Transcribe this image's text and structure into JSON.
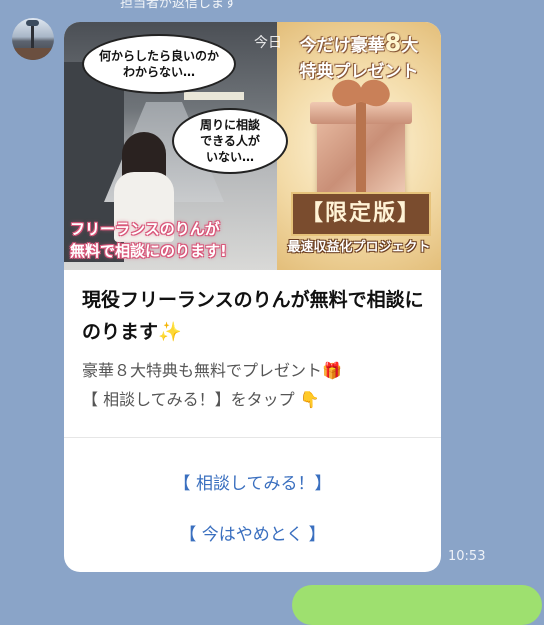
{
  "top_note": "担当者が返信します",
  "card": {
    "banner": {
      "time_label": "今日",
      "bubble1": "何からしたら良いのか\nわからない…",
      "bubble2": "周りに相談\nできる人が\nいない…",
      "banner_text_1": "フリーランスのりんが",
      "banner_text_2": "無料で相談にのります!",
      "promo_line1": "今だけ豪華",
      "promo_number": "8",
      "promo_line1_end": "大",
      "promo_line2": "特典プレゼント",
      "stamp": "【限定版】",
      "stamp_sub": "最速収益化プロジェクト"
    },
    "title": "現役フリーランスのりんが無料で相談にのります✨",
    "desc_line1": "豪華８大特典も無料でプレゼント🎁",
    "desc_line2": "【 相談してみる！】をタップ 👇",
    "actions": [
      {
        "label": "【 相談してみる！】"
      },
      {
        "label": "【 今はやめとく 】"
      }
    ]
  },
  "timestamp": "10:53",
  "colors": {
    "background": "#8aa4c8",
    "action_text": "#3a6fbf",
    "user_bubble": "#9ee06f"
  }
}
